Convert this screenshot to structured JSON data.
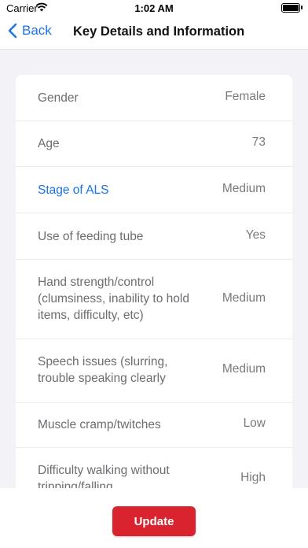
{
  "status_bar": {
    "carrier": "Carrier",
    "time": "1:02 AM"
  },
  "nav": {
    "back_label": "Back",
    "title": "Key Details and Information"
  },
  "details": [
    {
      "label": "Gender",
      "value": "Female"
    },
    {
      "label": "Age",
      "value": "73"
    },
    {
      "label": "Stage of ALS",
      "value": "Medium",
      "link": true
    },
    {
      "label": "Use of feeding tube",
      "value": "Yes"
    },
    {
      "label": "Hand strength/control (clumsiness, inability to hold items, difficulty, etc)",
      "value": "Medium"
    },
    {
      "label": "Speech issues (slurring, trouble speaking clearly",
      "value": "Medium"
    },
    {
      "label": "Muscle cramp/twitches",
      "value": "Low"
    },
    {
      "label": "Difficulty walking without tripping/falling",
      "value": "High"
    }
  ],
  "footer": {
    "update_label": "Update"
  },
  "colors": {
    "accent": "#1a73e8",
    "button": "#d9232e"
  },
  "icons": {
    "back": "chevron-left-icon",
    "wifi": "wifi-icon",
    "battery": "battery-icon"
  }
}
